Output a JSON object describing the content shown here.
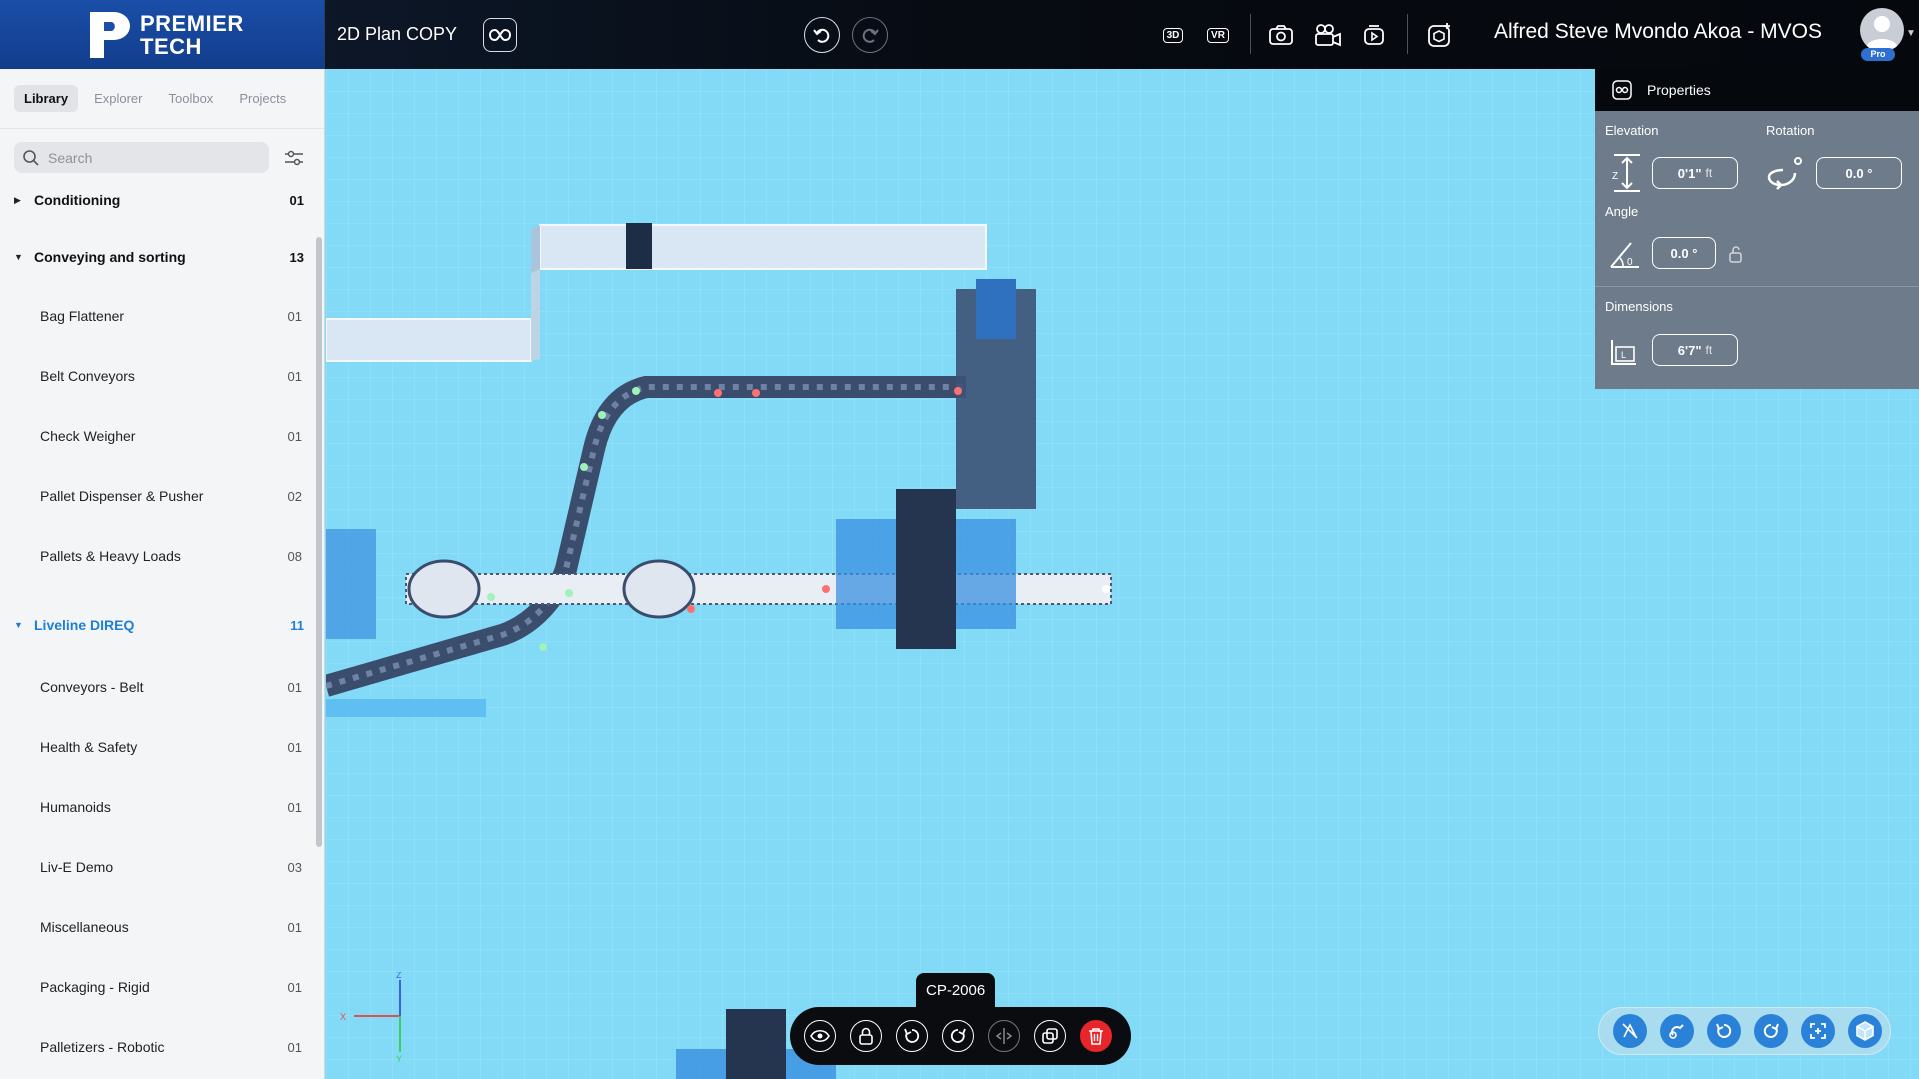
{
  "brand": {
    "line1": "PREMIER",
    "line2": "TECH"
  },
  "header": {
    "plan_title": "2D Plan  COPY",
    "view_3d": "3D",
    "view_vr": "VR",
    "user_name": "Alfred Steve Mvondo Akoa - MVOS",
    "user_badge": "Pro"
  },
  "sidebar": {
    "tabs": [
      "Library",
      "Explorer",
      "Toolbox",
      "Projects"
    ],
    "active_tab": "Library",
    "search_placeholder": "Search",
    "categories": [
      {
        "label": "Conditioning",
        "count": "01",
        "expanded": false
      },
      {
        "label": "Conveying and sorting",
        "count": "13",
        "expanded": true,
        "items": [
          {
            "label": "Bag Flattener",
            "count": "01"
          },
          {
            "label": "Belt Conveyors",
            "count": "01"
          },
          {
            "label": "Check Weigher",
            "count": "01"
          },
          {
            "label": "Pallet Dispenser & Pusher",
            "count": "02"
          },
          {
            "label": "Pallets & Heavy Loads",
            "count": "08"
          }
        ]
      },
      {
        "label": "Liveline DIREQ",
        "count": "11",
        "expanded": true,
        "highlighted": true,
        "items": [
          {
            "label": "Conveyors - Belt",
            "count": "01"
          },
          {
            "label": "Health & Safety",
            "count": "01"
          },
          {
            "label": "Humanoids",
            "count": "01"
          },
          {
            "label": "Liv-E Demo",
            "count": "03"
          },
          {
            "label": "Miscellaneous",
            "count": "01"
          },
          {
            "label": "Packaging - Rigid",
            "count": "01"
          },
          {
            "label": "Palletizers - Robotic",
            "count": "01"
          }
        ]
      }
    ]
  },
  "properties": {
    "title": "Properties",
    "elevation_label": "Elevation",
    "elevation_value": "0'1\"",
    "elevation_unit": "ft",
    "rotation_label": "Rotation",
    "rotation_value": "0.0 °",
    "angle_label": "Angle",
    "angle_value": "0.0 °",
    "dimensions_label": "Dimensions",
    "dimensions_value": "6'7\"",
    "dimensions_unit": "ft"
  },
  "selection": {
    "object_name": "CP-2006"
  },
  "axis": {
    "x": "X",
    "y": "Y",
    "z": "Z"
  },
  "colors": {
    "accent": "#1e7fd6",
    "viewport": "#82daf7",
    "delete": "#e6262a",
    "brand": "#1a4ea8"
  }
}
